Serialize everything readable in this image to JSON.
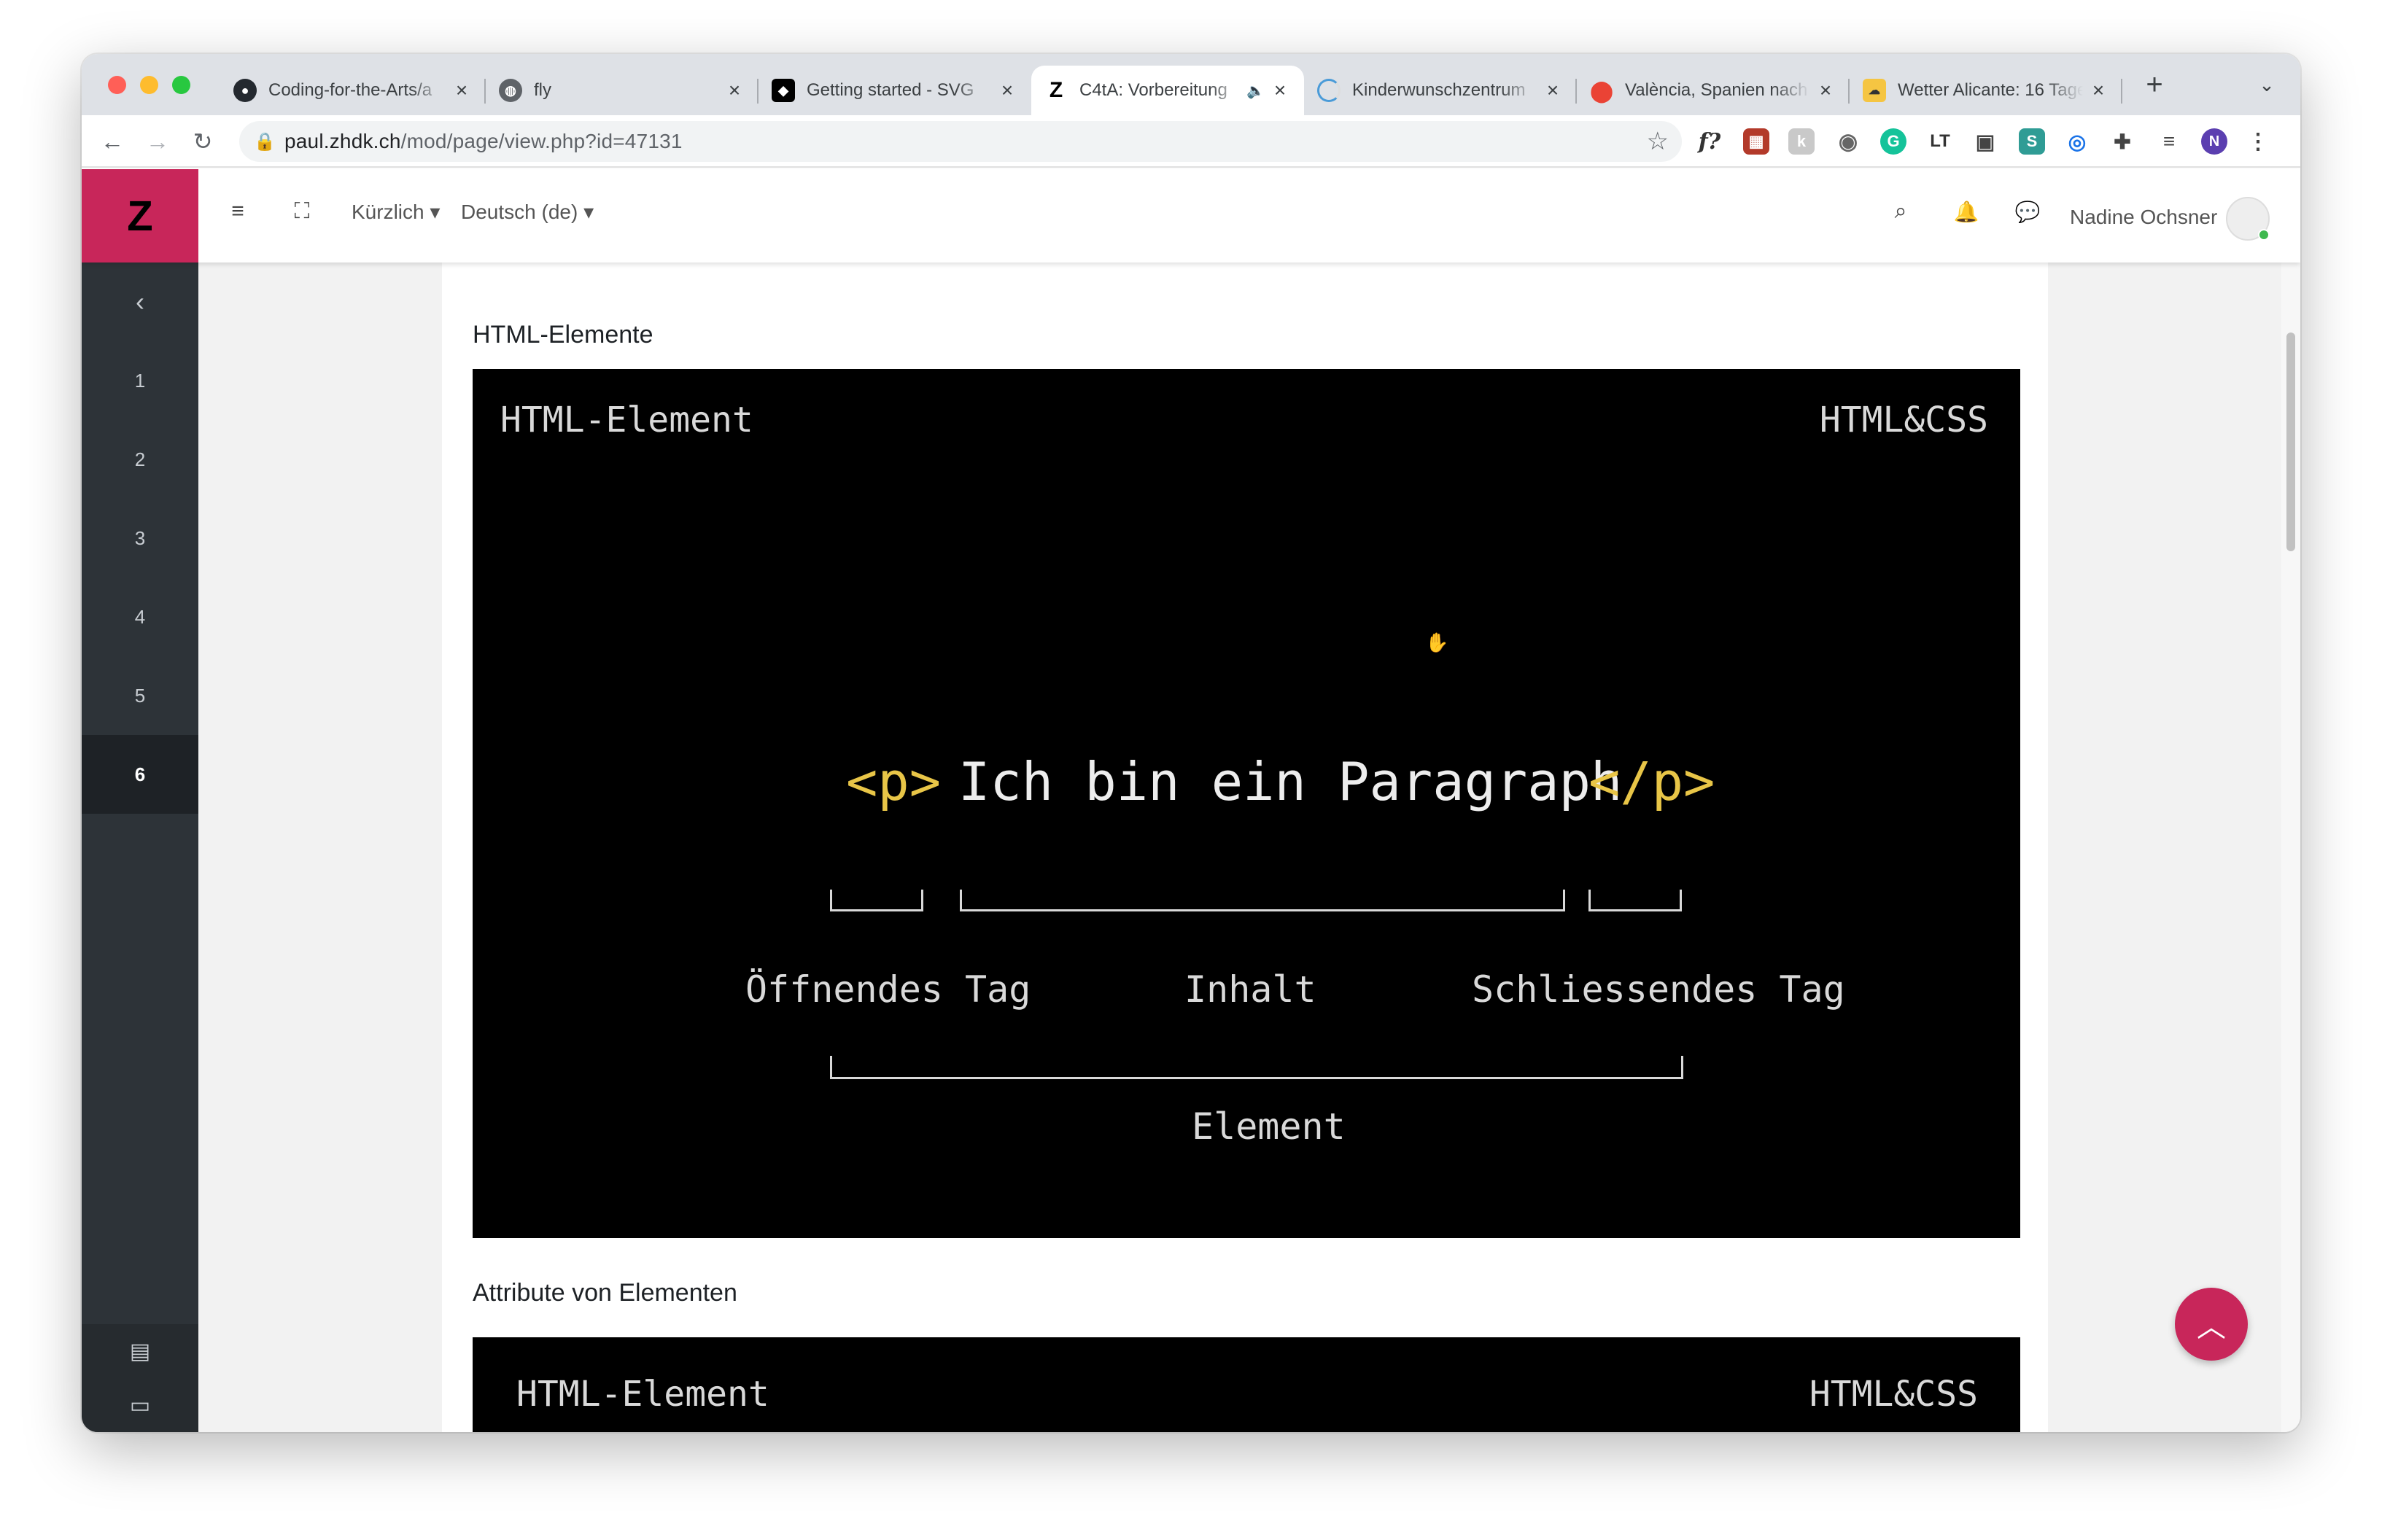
{
  "browser": {
    "tabs": [
      {
        "title": "Coding-for-the-Arts/a",
        "favicon": "github-icon"
      },
      {
        "title": "fly",
        "favicon": "globe-icon"
      },
      {
        "title": "Getting started - SVG",
        "favicon": "codepen-icon"
      },
      {
        "title": "C4tA: Vorbereitung",
        "favicon": "z-icon",
        "active": true,
        "audio": true
      },
      {
        "title": "Kinderwunschzentrum",
        "favicon": "loading-icon"
      },
      {
        "title": "València, Spanien nach",
        "favicon": "maps-icon"
      },
      {
        "title": "Wetter Alicante: 16 Tage",
        "favicon": "weather-icon"
      }
    ],
    "url_domain": "paul.zhdk.ch",
    "url_path": "/mod/page/view.php?id=47131",
    "profile_initial": "N"
  },
  "navbar": {
    "logo": "Z",
    "recent_label": "Kürzlich",
    "language_label": "Deutsch (de)",
    "user_name": "Nadine Ochsner"
  },
  "sidebar": {
    "items": [
      "1",
      "2",
      "3",
      "4",
      "5",
      "6"
    ],
    "active_index": 5
  },
  "content": {
    "section1_title": "HTML-Elemente",
    "section2_title": "Attribute von Elementen",
    "slide1": {
      "corner_left": "HTML-Element",
      "corner_right": "HTML&CSS",
      "open_tag": "<p>",
      "text": "Ich bin ein Paragraph",
      "close_tag": "</p>",
      "label_open": "Öffnendes Tag",
      "label_content": "Inhalt",
      "label_close": "Schliessendes Tag",
      "label_element": "Element"
    },
    "slide2": {
      "corner_left": "HTML-Element",
      "corner_right": "HTML&CSS"
    }
  },
  "colors": {
    "accent": "#c8265a",
    "tag_yellow": "#e8c547",
    "slide_bg": "#000000",
    "sidebar_bg": "#2d3338"
  }
}
